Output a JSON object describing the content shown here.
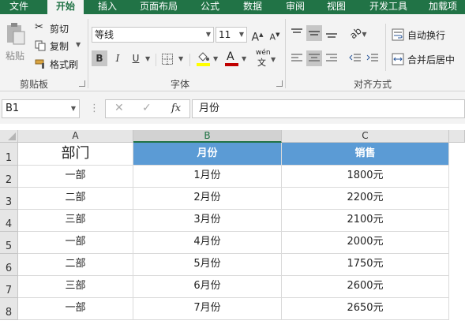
{
  "tabs": [
    {
      "label": "文件",
      "active": false
    },
    {
      "label": "开始",
      "active": true
    },
    {
      "label": "插入",
      "active": false
    },
    {
      "label": "页面布局",
      "active": false
    },
    {
      "label": "公式",
      "active": false
    },
    {
      "label": "数据",
      "active": false
    },
    {
      "label": "审阅",
      "active": false
    },
    {
      "label": "视图",
      "active": false
    },
    {
      "label": "开发工具",
      "active": false
    },
    {
      "label": "加载项",
      "active": false
    }
  ],
  "clipboard": {
    "paste": "粘贴",
    "cut": "剪切",
    "copy": "复制",
    "format_painter": "格式刷",
    "group": "剪贴板"
  },
  "font": {
    "name": "等线",
    "size": "11",
    "bold": "B",
    "italic": "I",
    "underline": "U",
    "phonetic": "wén",
    "group": "字体"
  },
  "alignment": {
    "wrap_text": "自动换行",
    "merge_center": "合并后居中",
    "group": "对齐方式"
  },
  "formula_bar": {
    "name_box": "B1",
    "fx": "fx",
    "value": "月份"
  },
  "columns": [
    "A",
    "B",
    "C"
  ],
  "selected_column": "B",
  "rows": [
    "1",
    "2",
    "3",
    "4",
    "5",
    "6",
    "7",
    "8"
  ],
  "cells": [
    [
      "部门",
      "月份",
      "销售"
    ],
    [
      "一部",
      "1月份",
      "1800元"
    ],
    [
      "二部",
      "2月份",
      "2200元"
    ],
    [
      "三部",
      "3月份",
      "2100元"
    ],
    [
      "一部",
      "4月份",
      "2000元"
    ],
    [
      "二部",
      "5月份",
      "1750元"
    ],
    [
      "三部",
      "6月份",
      "2600元"
    ],
    [
      "一部",
      "7月份",
      "2650元"
    ]
  ],
  "colors": {
    "excel_green": "#217346",
    "header_fill": "#5b9bd5",
    "font_color_bar": "#c00000",
    "highlight_bar": "#ffff00"
  }
}
